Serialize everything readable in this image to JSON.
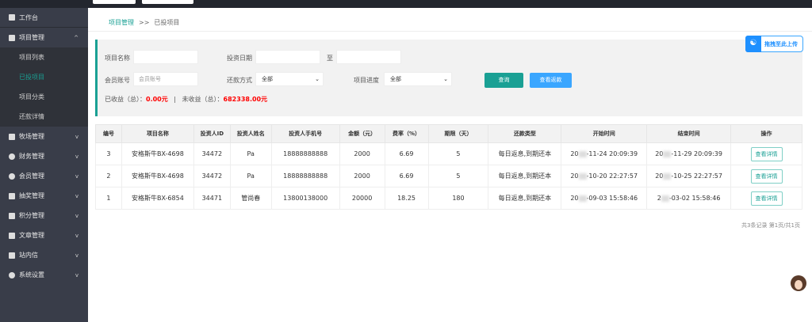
{
  "sidebar": {
    "items": [
      {
        "label": "工作台",
        "icon": "dashboard-icon"
      },
      {
        "label": "项目管理",
        "icon": "clipboard-icon",
        "expanded": true,
        "children": [
          {
            "label": "项目列表"
          },
          {
            "label": "已投项目",
            "active": true
          },
          {
            "label": "项目分类"
          },
          {
            "label": "还款详情"
          }
        ]
      },
      {
        "label": "牧场管理",
        "icon": "clipboard-icon"
      },
      {
        "label": "财务管理",
        "icon": "coin-icon"
      },
      {
        "label": "会员管理",
        "icon": "user-icon"
      },
      {
        "label": "抽奖管理",
        "icon": "gift-icon"
      },
      {
        "label": "积分管理",
        "icon": "points-icon"
      },
      {
        "label": "文章管理",
        "icon": "document-icon"
      },
      {
        "label": "站内信",
        "icon": "message-icon"
      },
      {
        "label": "系统设置",
        "icon": "gear-icon"
      }
    ]
  },
  "breadcrumb": {
    "parent": "项目管理",
    "separator": ">>",
    "current": "已投项目"
  },
  "filter": {
    "project_name_label": "项目名称",
    "project_name_value": "",
    "invest_date_label": "投资日期",
    "to_label": "至",
    "member_label": "会员账号",
    "member_placeholder": "会员账号",
    "repay_label": "还款方式",
    "repay_value": "全部",
    "progress_label": "项目进度",
    "progress_value": "全部",
    "query_btn": "查询",
    "rebate_btn": "查看返款"
  },
  "stats": {
    "earned_label": "已收益（总）：",
    "earned": "0.00元",
    "sep": "|",
    "unearned_label": "未收益（总）：",
    "unearned": "682338.00元"
  },
  "upload": {
    "label": "拖拽至此上传"
  },
  "table": {
    "headers": [
      "编号",
      "项目名称",
      "投资人ID",
      "投资人姓名",
      "投资人手机号",
      "金额（元）",
      "费率（%）",
      "期限（天）",
      "还款类型",
      "开始时间",
      "结束时间",
      "操作"
    ],
    "rows": [
      {
        "id": "3",
        "name": "安格斯牛BX-4698",
        "uid": "34472",
        "uname": "Pa",
        "phone": "18888888888",
        "amount": "2000",
        "rate": "6.69",
        "days": "5",
        "type": "每日返息,到期还本",
        "start_a": "20",
        "start_b": "-11-24 20:09:39",
        "end_a": "20",
        "end_b": "-11-29 20:09:39",
        "action": "查看详情"
      },
      {
        "id": "2",
        "name": "安格斯牛BX-4698",
        "uid": "34472",
        "uname": "Pa",
        "phone": "18888888888",
        "amount": "2000",
        "rate": "6.69",
        "days": "5",
        "type": "每日返息,到期还本",
        "start_a": "20",
        "start_b": "-10-20 22:27:57",
        "end_a": "20",
        "end_b": "-10-25 22:27:57",
        "action": "查看详情"
      },
      {
        "id": "1",
        "name": "安格斯牛BX-6854",
        "uid": "34471",
        "uname": "管尚春",
        "phone": "13800138000",
        "amount": "20000",
        "rate": "18.25",
        "days": "180",
        "type": "每日返息,到期还本",
        "start_a": "20",
        "start_b": "-09-03 15:58:46",
        "end_a": "2",
        "end_b": "-03-02 15:58:46",
        "action": "查看详情"
      }
    ]
  },
  "pager": "共3条记录 第1页/共1页"
}
